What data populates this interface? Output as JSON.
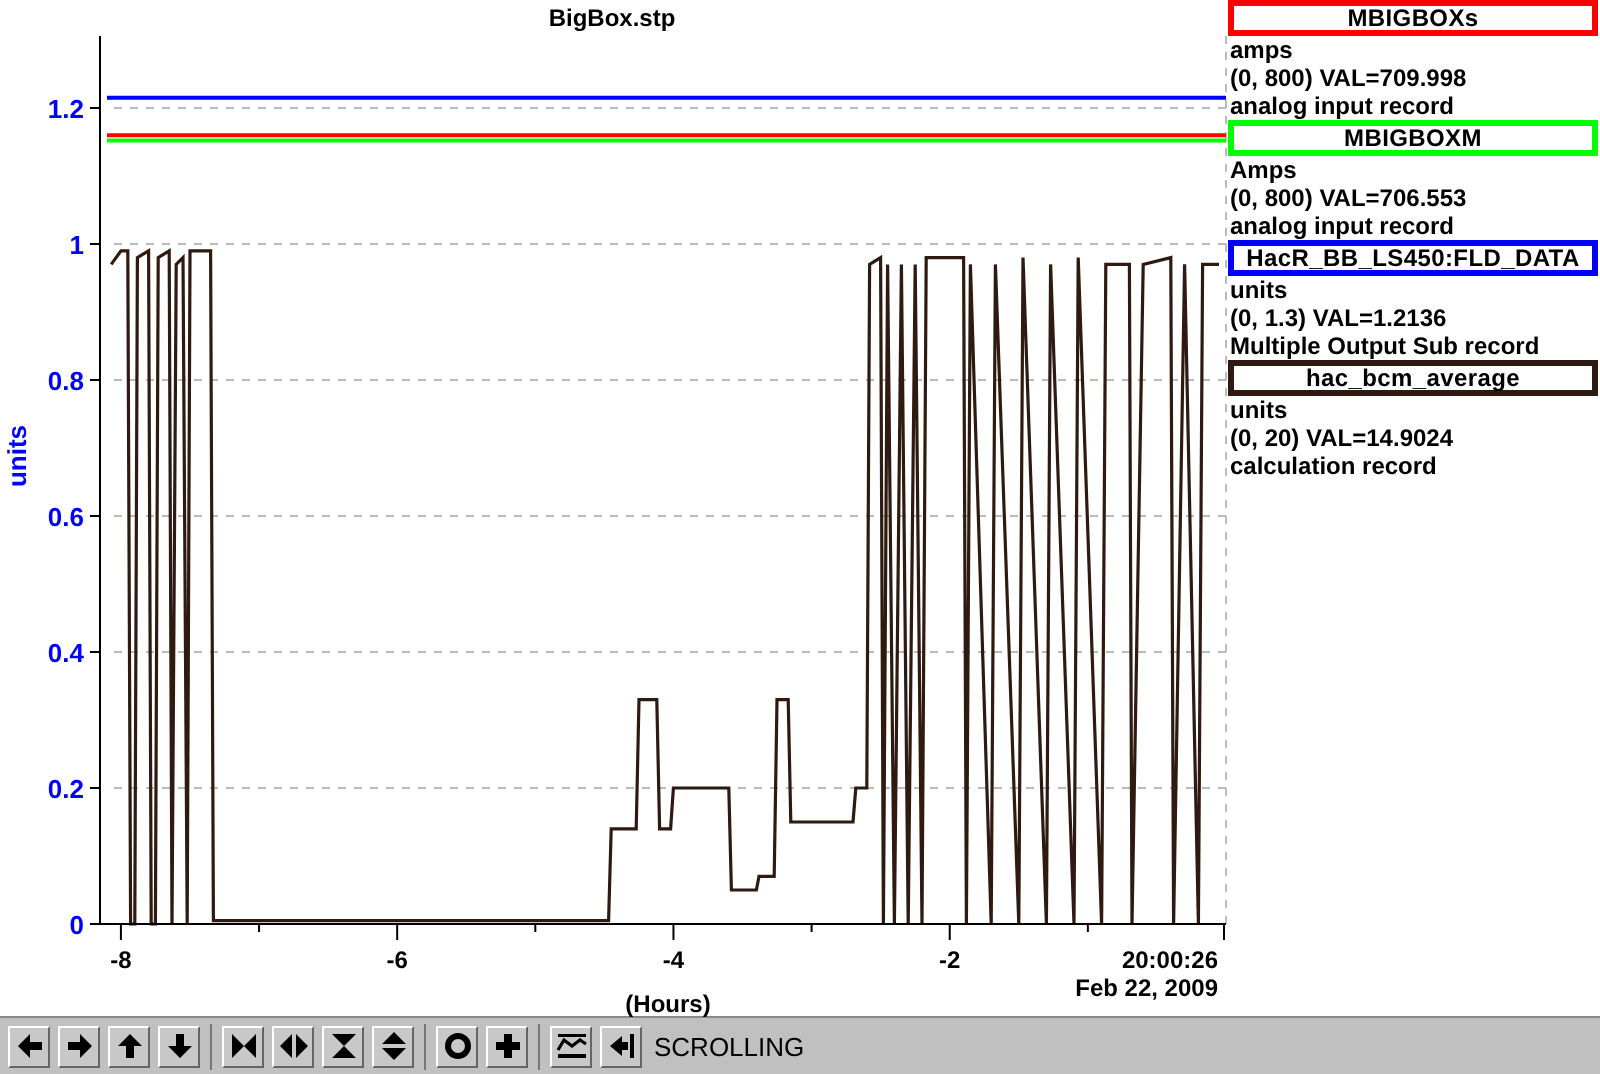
{
  "plot": {
    "title": "BigBox.stp",
    "time": "20:00:26",
    "date": "Feb 22, 2009",
    "chart_data": {
      "type": "line",
      "ylabel": "units",
      "xlabel": "(Hours)",
      "xlim": [
        -8.1,
        0
      ],
      "ylim": [
        0,
        1.3
      ],
      "xticks": [
        -8,
        -6,
        -4,
        -2
      ],
      "yticks": [
        0,
        0.2,
        0.4,
        0.6,
        0.8,
        1,
        1.2
      ],
      "grid": true,
      "series": [
        {
          "color": "#0000ff",
          "x": [
            -8.1,
            0
          ],
          "values": [
            1.215,
            1.215
          ]
        },
        {
          "color": "#ff0000",
          "x": [
            -8.1,
            0
          ],
          "values": [
            1.16,
            1.16
          ]
        },
        {
          "color": "#00ff00",
          "x": [
            -8.1,
            0
          ],
          "values": [
            1.152,
            1.152
          ]
        },
        {
          "color": "#2e1a10",
          "x": [
            -8.07,
            -8.0,
            -7.95,
            -7.93,
            -7.9,
            -7.88,
            -7.8,
            -7.78,
            -7.75,
            -7.73,
            -7.65,
            -7.63,
            -7.6,
            -7.55,
            -7.52,
            -7.5,
            -7.35,
            -7.33,
            -4.47,
            -4.45,
            -4.27,
            -4.25,
            -4.12,
            -4.1,
            -4.02,
            -4.0,
            -3.6,
            -3.58,
            -3.4,
            -3.38,
            -3.27,
            -3.25,
            -3.17,
            -3.15,
            -2.7,
            -2.68,
            -2.6,
            -2.58,
            -2.5,
            -2.48,
            -2.45,
            -2.4,
            -2.35,
            -2.3,
            -2.25,
            -2.2,
            -2.17,
            -1.9,
            -1.88,
            -1.85,
            -1.7,
            -1.67,
            -1.5,
            -1.47,
            -1.3,
            -1.27,
            -1.1,
            -1.07,
            -0.9,
            -0.87,
            -0.7,
            -0.68,
            -0.6,
            -0.4,
            -0.38,
            -0.3,
            -0.2,
            -0.17,
            -0.05
          ],
          "values": [
            0.97,
            0.99,
            0.99,
            0,
            0,
            0.98,
            0.99,
            0,
            0,
            0.98,
            0.99,
            0,
            0.97,
            0.98,
            0,
            0.99,
            0.99,
            0.005,
            0.005,
            0.14,
            0.14,
            0.33,
            0.33,
            0.14,
            0.14,
            0.2,
            0.2,
            0.05,
            0.05,
            0.07,
            0.07,
            0.33,
            0.33,
            0.15,
            0.15,
            0.2,
            0.2,
            0.97,
            0.98,
            0,
            0.97,
            0,
            0.97,
            0,
            0.97,
            0,
            0.98,
            0.98,
            0,
            0.97,
            0,
            0.97,
            0,
            0.98,
            0,
            0.97,
            0,
            0.98,
            0,
            0.97,
            0.97,
            0,
            0.97,
            0.98,
            0,
            0.97,
            0,
            0.97,
            0.97
          ]
        }
      ]
    }
  },
  "legend": [
    {
      "name": "MBIGBOXs",
      "color": "#ff0000",
      "lines": [
        "amps",
        "(0, 800) VAL=709.998",
        "analog input record"
      ]
    },
    {
      "name": "MBIGBOXM",
      "color": "#00ff00",
      "lines": [
        "Amps",
        "(0, 800) VAL=706.553",
        "analog input record"
      ]
    },
    {
      "name": "HacR_BB_LS450:FLD_DATA",
      "color": "#0000ff",
      "lines": [
        "units",
        "(0, 1.3) VAL=1.2136",
        "Multiple Output Sub record"
      ]
    },
    {
      "name": "hac_bcm_average",
      "color": "#2e1a10",
      "lines": [
        "units",
        "(0, 20) VAL=14.9024",
        "calculation record"
      ]
    }
  ],
  "toolbar": {
    "groups": [
      {
        "buttons": [
          {
            "kind": "left"
          },
          {
            "kind": "right"
          },
          {
            "kind": "up"
          },
          {
            "kind": "down"
          }
        ]
      },
      {
        "buttons": [
          {
            "kind": "hcompress"
          },
          {
            "kind": "hexpand"
          },
          {
            "kind": "vcompress"
          },
          {
            "kind": "vexpand"
          }
        ]
      },
      {
        "buttons": [
          {
            "kind": "circle"
          },
          {
            "kind": "plus"
          }
        ]
      },
      {
        "buttons": [
          {
            "kind": "wave"
          },
          {
            "kind": "pin"
          }
        ]
      }
    ],
    "status": "SCROLLING"
  }
}
